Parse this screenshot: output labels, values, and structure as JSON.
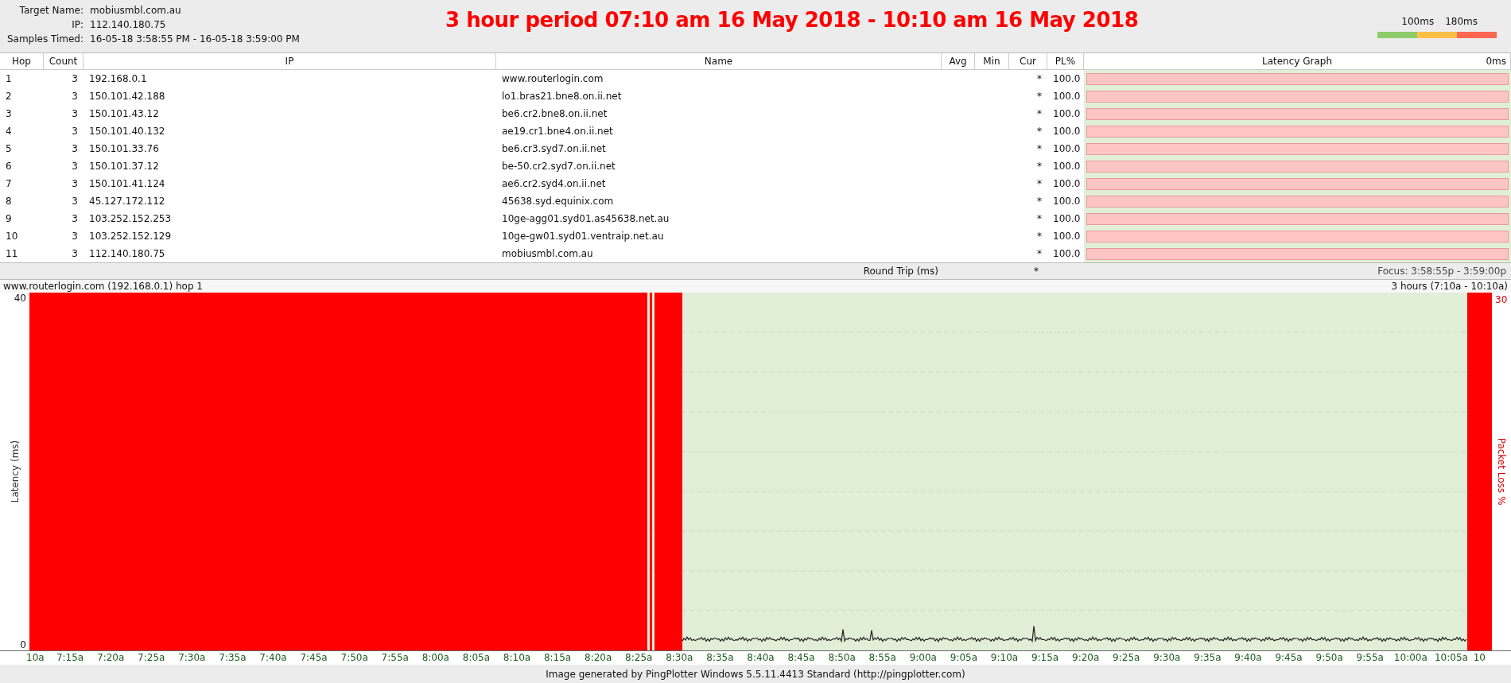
{
  "header": {
    "fields": [
      {
        "label": "Target Name:",
        "value": "mobiusmbl.com.au"
      },
      {
        "label": "IP:",
        "value": "112.140.180.75"
      },
      {
        "label": "Samples Timed:",
        "value": "16-05-18 3:58:55 PM - 16-05-18 3:59:00 PM"
      }
    ],
    "title": "3 hour period 07:10 am 16 May 2018 - 10:10 am 16 May 2018",
    "legend": [
      "100ms",
      "180ms"
    ]
  },
  "table": {
    "columns": [
      "Hop",
      "Count",
      "IP",
      "Name",
      "Avg",
      "Min",
      "Cur",
      "PL%",
      "Latency Graph"
    ],
    "graph_scale": "0ms",
    "rows": [
      {
        "hop": "1",
        "count": "3",
        "ip": "192.168.0.1",
        "name": "www.routerlogin.com",
        "cur": "*",
        "pl": "100.0",
        "level": 1
      },
      {
        "hop": "2",
        "count": "3",
        "ip": "150.101.42.188",
        "name": "lo1.bras21.bne8.on.ii.net",
        "cur": "*",
        "pl": "100.0",
        "level": 1
      },
      {
        "hop": "3",
        "count": "3",
        "ip": "150.101.43.12",
        "name": "be6.cr2.bne8.on.ii.net",
        "cur": "*",
        "pl": "100.0",
        "level": 1
      },
      {
        "hop": "4",
        "count": "3",
        "ip": "150.101.40.132",
        "name": "ae19.cr1.bne4.on.ii.net",
        "cur": "*",
        "pl": "100.0",
        "level": 1
      },
      {
        "hop": "5",
        "count": "3",
        "ip": "150.101.33.76",
        "name": "be6.cr3.syd7.on.ii.net",
        "cur": "*",
        "pl": "100.0",
        "level": 1
      },
      {
        "hop": "6",
        "count": "3",
        "ip": "150.101.37.12",
        "name": "be-50.cr2.syd7.on.ii.net",
        "cur": "*",
        "pl": "100.0",
        "level": 1
      },
      {
        "hop": "7",
        "count": "3",
        "ip": "150.101.41.124",
        "name": "ae6.cr2.syd4.on.ii.net",
        "cur": "*",
        "pl": "100.0",
        "level": 1
      },
      {
        "hop": "8",
        "count": "3",
        "ip": "45.127.172.112",
        "name": "45638.syd.equinix.com",
        "cur": "*",
        "pl": "100.0",
        "level": 1
      },
      {
        "hop": "9",
        "count": "3",
        "ip": "103.252.152.253",
        "name": "10ge-agg01.syd01.as45638.net.au",
        "cur": "*",
        "pl": "100.0",
        "level": 1
      },
      {
        "hop": "10",
        "count": "3",
        "ip": "103.252.152.129",
        "name": "10ge-gw01.syd01.ventraip.net.au",
        "cur": "*",
        "pl": "100.0",
        "level": 1
      },
      {
        "hop": "11",
        "count": "3",
        "ip": "112.140.180.75",
        "name": "mobiusmbl.com.au",
        "cur": "*",
        "pl": "100.0",
        "level": 1
      }
    ],
    "footer": {
      "label": "Round Trip (ms)",
      "cur": "*",
      "focus": "Focus: 3:58:55p - 3:59:00p"
    }
  },
  "chart": {
    "title": "www.routerlogin.com (192.168.0.1) hop 1",
    "range": "3 hours (7:10a - 10:10a)",
    "ylabel": "Latency (ms)",
    "y_ticks": [
      "40",
      "0"
    ],
    "y2label": "Packet Loss %",
    "y2_ticks": [
      "30"
    ],
    "x_ticks": [
      "10a",
      "7:15a",
      "7:20a",
      "7:25a",
      "7:30a",
      "7:35a",
      "7:40a",
      "7:45a",
      "7:50a",
      "7:55a",
      "8:00a",
      "8:05a",
      "8:10a",
      "8:15a",
      "8:20a",
      "8:25a",
      "8:30a",
      "8:35a",
      "8:40a",
      "8:45a",
      "8:50a",
      "8:55a",
      "9:00a",
      "9:05a",
      "9:10a",
      "9:15a",
      "9:20a",
      "9:25a",
      "9:30a",
      "9:35a",
      "9:40a",
      "9:45a",
      "9:50a",
      "9:55a",
      "10:00a",
      "10:05a",
      "10"
    ]
  },
  "status_bar": "Image generated by PingPlotter Windows 5.5.11.4413 Standard (http://pingplotter.com)"
}
